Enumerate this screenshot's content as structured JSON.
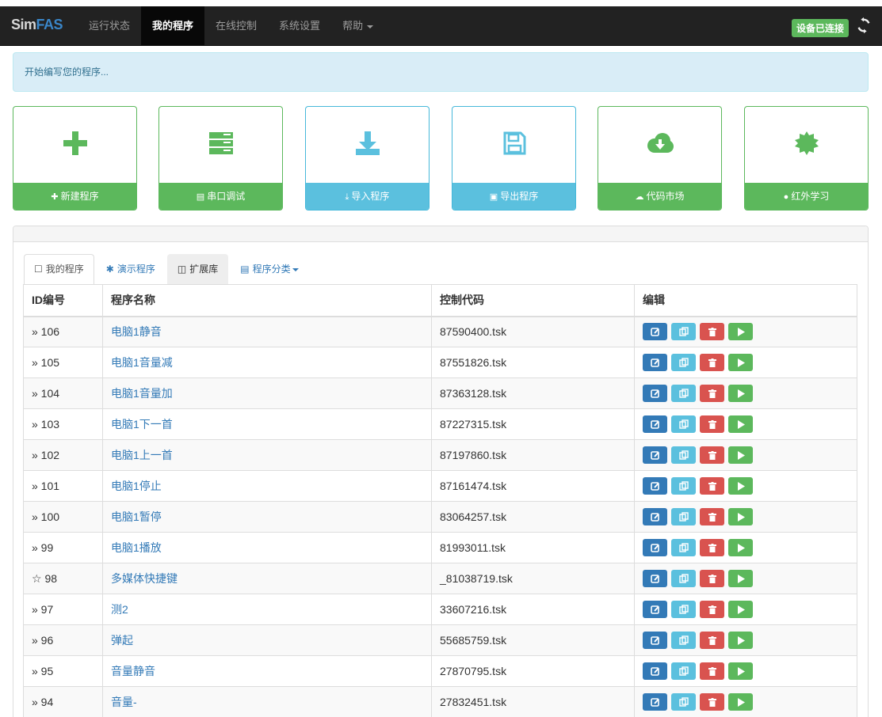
{
  "navbar": {
    "brand_part1": "Sim",
    "brand_part2": "FAS",
    "items": [
      {
        "label": "运行状态",
        "active": false
      },
      {
        "label": "我的程序",
        "active": true
      },
      {
        "label": "在线控制",
        "active": false
      },
      {
        "label": "系统设置",
        "active": false
      },
      {
        "label": "帮助",
        "active": false
      }
    ],
    "status_badge": "设备已连接"
  },
  "alert": {
    "text": "开始编写您的程序..."
  },
  "tiles": [
    {
      "label": "新建程序",
      "glyph": "✚",
      "icon": "plus-icon",
      "color": "green"
    },
    {
      "label": "串口调试",
      "glyph": "▤",
      "icon": "tasks-icon",
      "color": "green"
    },
    {
      "label": "导入程序",
      "glyph": "⤓",
      "icon": "import-icon",
      "color": "blue"
    },
    {
      "label": "导出程序",
      "glyph": "▣",
      "icon": "floppy-icon",
      "color": "blue"
    },
    {
      "label": "代码市场",
      "glyph": "☁",
      "icon": "cloud-download-icon",
      "color": "green"
    },
    {
      "label": "红外学习",
      "glyph": "●",
      "icon": "certificate-icon",
      "color": "green"
    }
  ],
  "tabs": [
    {
      "label": "我的程序",
      "glyph": "☐"
    },
    {
      "label": "演示程序",
      "glyph": "✱"
    },
    {
      "label": "扩展库",
      "glyph": "◫"
    },
    {
      "label": "程序分类",
      "glyph": "▤"
    }
  ],
  "table": {
    "headers": [
      "ID编号",
      "程序名称",
      "控制代码",
      "编辑"
    ],
    "rows": [
      {
        "id": "» 106",
        "name": "电脑1静音",
        "code": "87590400.tsk"
      },
      {
        "id": "» 105",
        "name": "电脑1音量减",
        "code": "87551826.tsk"
      },
      {
        "id": "» 104",
        "name": "电脑1音量加",
        "code": "87363128.tsk"
      },
      {
        "id": "» 103",
        "name": "电脑1下一首",
        "code": "87227315.tsk"
      },
      {
        "id": "» 102",
        "name": "电脑1上一首",
        "code": "87197860.tsk"
      },
      {
        "id": "» 101",
        "name": "电脑1停止",
        "code": "87161474.tsk"
      },
      {
        "id": "» 100",
        "name": "电脑1暂停",
        "code": "83064257.tsk"
      },
      {
        "id": "» 99",
        "name": "电脑1播放",
        "code": "81993011.tsk"
      },
      {
        "id": "☆ 98",
        "name": "多媒体快捷键",
        "code": "_81038719.tsk"
      },
      {
        "id": "» 97",
        "name": "测2",
        "code": "33607216.tsk"
      },
      {
        "id": "» 96",
        "name": "弹起",
        "code": "55685759.tsk"
      },
      {
        "id": "» 95",
        "name": "音量静音",
        "code": "27870795.tsk"
      },
      {
        "id": "» 94",
        "name": "音量-",
        "code": "27832451.tsk"
      }
    ]
  }
}
